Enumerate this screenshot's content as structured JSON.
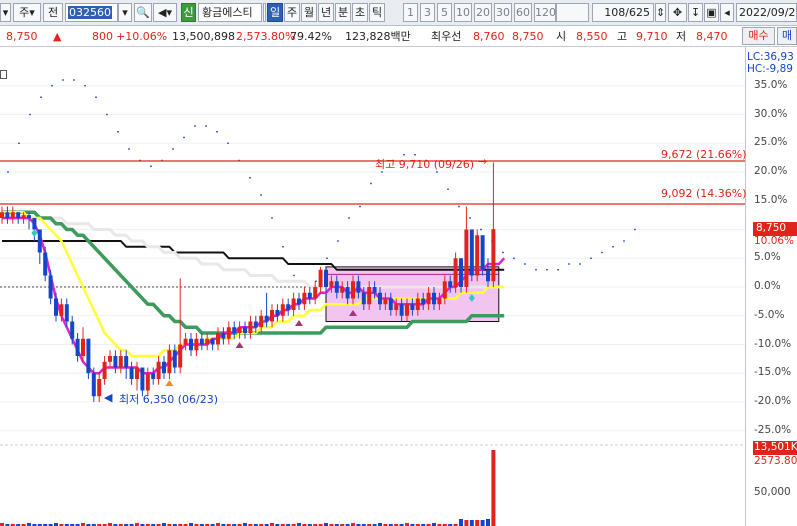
{
  "toolbar": {
    "period_select": "주",
    "market_select": "전",
    "stock_code": "032560",
    "indicator_badge": "신",
    "stock_name": "황금에스티",
    "tabs": [
      "일",
      "주",
      "월",
      "년",
      "분",
      "초",
      "틱"
    ],
    "active_tab": "일",
    "intervals": [
      "1",
      "3",
      "5",
      "10",
      "20",
      "30",
      "60",
      "120"
    ],
    "count": "108/625",
    "date": "2022/09/26"
  },
  "quote": {
    "price": "8,750",
    "direction": "▲",
    "change": "800",
    "change_pct": "+10.06%",
    "volume": "13,500,898",
    "volume_pct": "2,573.80%",
    "ratio": "79.42%",
    "trade_value": "123,828백만",
    "best_label": "최우선",
    "best_ask": "8,760",
    "best_bid": "8,750",
    "open_label": "시",
    "open": "8,550",
    "high_label": "고",
    "high": "9,710",
    "low_label": "저",
    "low": "8,470",
    "buy_button": "매수",
    "sell_button": "매"
  },
  "legend": {
    "lc": "LC:36,93",
    "hc": "HC:-9,89"
  },
  "annotations": {
    "high_marker": "최고 9,710 (09/26)",
    "low_marker": "최저 6,350 (06/23)",
    "line1": "9,672 (21.66%)",
    "line2": "9,092 (14.36%)",
    "price_tag": "8,750",
    "price_tag_pct": "10.06%",
    "volume_tag": "13,501K",
    "volume_tag2": "2573.80"
  },
  "colors": {
    "up": "#e0241c",
    "down": "#1446c8",
    "ma5": "#e61fd2",
    "ma20": "#ffff33",
    "ma60": "#3f9b5d",
    "ma120": "#e8e8e8",
    "ma240": "#111111",
    "box": "#f2c4f0"
  },
  "chart_data": {
    "type": "candlestick",
    "y_axis_ticks": [
      "35.0%",
      "30.0%",
      "25.0%",
      "20.0%",
      "15.0%",
      "10.0%",
      "5.0%",
      "0.0%",
      "-5.0%",
      "-10.0%",
      "-15.0%",
      "-20.0%",
      "-25.0%"
    ],
    "volume_axis_ticks": [
      "50,000"
    ],
    "candles": [
      {
        "o": 12,
        "c": 13,
        "h": 14,
        "l": 11
      },
      {
        "o": 13,
        "c": 12,
        "h": 14,
        "l": 11
      },
      {
        "o": 12,
        "c": 13,
        "h": 14,
        "l": 11
      },
      {
        "o": 13,
        "c": 12,
        "h": 13,
        "l": 11
      },
      {
        "o": 12,
        "c": 12.5,
        "h": 13,
        "l": 11
      },
      {
        "o": 12.5,
        "c": 12,
        "h": 13,
        "l": 10
      },
      {
        "o": 12,
        "c": 10,
        "h": 12,
        "l": 8
      },
      {
        "o": 10,
        "c": 6,
        "h": 10,
        "l": 4
      },
      {
        "o": 6,
        "c": 2,
        "h": 7,
        "l": 1
      },
      {
        "o": 2,
        "c": -2,
        "h": 3,
        "l": -3
      },
      {
        "o": -2,
        "c": -5,
        "h": -1,
        "l": -6
      },
      {
        "o": -5,
        "c": -3,
        "h": -2,
        "l": -6
      },
      {
        "o": -3,
        "c": -6,
        "h": -2,
        "l": -7
      },
      {
        "o": -6,
        "c": -9,
        "h": -5,
        "l": -10
      },
      {
        "o": -9,
        "c": -12,
        "h": -8,
        "l": -13
      },
      {
        "o": -12,
        "c": -9,
        "h": -7,
        "l": -13
      },
      {
        "o": -9,
        "c": -15,
        "h": -9,
        "l": -16
      },
      {
        "o": -15,
        "c": -19,
        "h": -14,
        "l": -20
      },
      {
        "o": -19,
        "c": -16,
        "h": -15,
        "l": -20
      },
      {
        "o": -16,
        "c": -13,
        "h": -12,
        "l": -17
      },
      {
        "o": -13,
        "c": -12,
        "h": -11,
        "l": -14
      },
      {
        "o": -12,
        "c": -14,
        "h": -11,
        "l": -15
      },
      {
        "o": -14,
        "c": -12,
        "h": -11,
        "l": -15
      },
      {
        "o": -12,
        "c": -14,
        "h": -11,
        "l": -16
      },
      {
        "o": -14,
        "c": -16,
        "h": -13,
        "l": -17
      },
      {
        "o": -16,
        "c": -14,
        "h": -13,
        "l": -18
      },
      {
        "o": -14,
        "c": -18,
        "h": -14,
        "l": -19
      },
      {
        "o": -18,
        "c": -15,
        "h": -14,
        "l": -19
      },
      {
        "o": -15,
        "c": -16,
        "h": -14,
        "l": -17
      },
      {
        "o": -16,
        "c": -13,
        "h": -12,
        "l": -17
      },
      {
        "o": -13,
        "c": -15,
        "h": -12,
        "l": -16
      },
      {
        "o": -15,
        "c": -11,
        "h": -10,
        "l": -16
      },
      {
        "o": -11,
        "c": -14,
        "h": -10,
        "l": -15
      },
      {
        "o": -14,
        "c": -10,
        "h": 1.5,
        "l": -15
      },
      {
        "o": -10,
        "c": -9,
        "h": -8,
        "l": -11
      },
      {
        "o": -9,
        "c": -11,
        "h": -8,
        "l": -12
      },
      {
        "o": -11,
        "c": -9,
        "h": -8,
        "l": -12
      },
      {
        "o": -9,
        "c": -10,
        "h": -8,
        "l": -11
      },
      {
        "o": -10,
        "c": -9,
        "h": -8,
        "l": -11
      },
      {
        "o": -9,
        "c": -10,
        "h": -9,
        "l": -11
      },
      {
        "o": -10,
        "c": -8,
        "h": -7,
        "l": -11
      },
      {
        "o": -8,
        "c": -9,
        "h": -7,
        "l": -10
      },
      {
        "o": -9,
        "c": -7,
        "h": -6,
        "l": -10
      },
      {
        "o": -7,
        "c": -8,
        "h": -6,
        "l": -9
      },
      {
        "o": -8,
        "c": -7,
        "h": -6,
        "l": -9
      },
      {
        "o": -7,
        "c": -8,
        "h": -6,
        "l": -9
      },
      {
        "o": -8,
        "c": -6,
        "h": -5,
        "l": -9
      },
      {
        "o": -6,
        "c": -7,
        "h": -5,
        "l": -8
      },
      {
        "o": -7,
        "c": -5,
        "h": -4,
        "l": -8
      },
      {
        "o": -5,
        "c": -6,
        "h": -1,
        "l": -7
      },
      {
        "o": -6,
        "c": -4,
        "h": -3,
        "l": -7
      },
      {
        "o": -4,
        "c": -5,
        "h": -3,
        "l": -6
      },
      {
        "o": -5,
        "c": -3,
        "h": -2,
        "l": -6
      },
      {
        "o": -3,
        "c": -4,
        "h": -2,
        "l": -5
      },
      {
        "o": -4,
        "c": -2,
        "h": -1,
        "l": -5
      },
      {
        "o": -2,
        "c": -3,
        "h": -1,
        "l": -4
      },
      {
        "o": -3,
        "c": -1,
        "h": 0,
        "l": -4
      },
      {
        "o": -1,
        "c": -2,
        "h": 0,
        "l": -3
      },
      {
        "o": -2,
        "c": 0,
        "h": 1,
        "l": -3
      },
      {
        "o": 0,
        "c": 3,
        "h": 3.5,
        "l": -1
      },
      {
        "o": 3,
        "c": 0,
        "h": 3,
        "l": -1
      },
      {
        "o": 0,
        "c": 1,
        "h": 2,
        "l": -1
      },
      {
        "o": 1,
        "c": -1,
        "h": 2,
        "l": -2
      },
      {
        "o": -1,
        "c": 0,
        "h": 1,
        "l": -2
      },
      {
        "o": 0,
        "c": -2,
        "h": 1,
        "l": -3
      },
      {
        "o": -2,
        "c": 1,
        "h": 2,
        "l": -3
      },
      {
        "o": 1,
        "c": -1,
        "h": 2,
        "l": -2
      },
      {
        "o": -1,
        "c": -3,
        "h": 0,
        "l": -4
      },
      {
        "o": -3,
        "c": 0,
        "h": 1,
        "l": -4
      },
      {
        "o": 0,
        "c": -1,
        "h": 1,
        "l": -2
      },
      {
        "o": -1,
        "c": -3,
        "h": 0,
        "l": -4
      },
      {
        "o": -3,
        "c": -2,
        "h": -1,
        "l": -4
      },
      {
        "o": -2,
        "c": -4,
        "h": -1,
        "l": -5
      },
      {
        "o": -4,
        "c": -3,
        "h": -2,
        "l": -5
      },
      {
        "o": -3,
        "c": -5,
        "h": -2,
        "l": -6
      },
      {
        "o": -5,
        "c": -3,
        "h": -2,
        "l": -6
      },
      {
        "o": -3,
        "c": -4,
        "h": -2,
        "l": -5
      },
      {
        "o": -4,
        "c": -2,
        "h": -1,
        "l": -5
      },
      {
        "o": -2,
        "c": -3,
        "h": -1,
        "l": -4
      },
      {
        "o": -3,
        "c": -1,
        "h": 0,
        "l": -4
      },
      {
        "o": -1,
        "c": -3,
        "h": 0,
        "l": -4
      },
      {
        "o": -3,
        "c": -2,
        "h": -1,
        "l": -4
      },
      {
        "o": -2,
        "c": 1,
        "h": 2,
        "l": -3
      },
      {
        "o": 1,
        "c": 0,
        "h": 2,
        "l": -1
      },
      {
        "o": 0,
        "c": 5,
        "h": 6,
        "l": -1
      },
      {
        "o": 5,
        "c": 0,
        "h": 5,
        "l": -1
      },
      {
        "o": 0,
        "c": 10,
        "h": 14,
        "l": -1
      },
      {
        "o": 10,
        "c": 2,
        "h": 10,
        "l": 1
      },
      {
        "o": 2,
        "c": 9,
        "h": 10,
        "l": 1
      },
      {
        "o": 9,
        "c": 3,
        "h": 9,
        "l": 2
      },
      {
        "o": 3,
        "c": 1,
        "h": 5,
        "l": 0
      },
      {
        "o": 1,
        "c": 10.06,
        "h": 21.66,
        "l": 0
      }
    ],
    "ma": {
      "ma5": [
        12,
        12,
        12,
        12,
        12,
        12,
        11,
        9,
        6,
        2,
        -2,
        -5,
        -7,
        -9,
        -11,
        -13,
        -14,
        -15,
        -15,
        -14,
        -14,
        -14,
        -14,
        -14,
        -14,
        -14,
        -15,
        -15,
        -15,
        -14,
        -14,
        -13,
        -12,
        -11,
        -10,
        -10,
        -10,
        -10,
        -10,
        -9,
        -9,
        -8,
        -8,
        -8,
        -7,
        -7,
        -7,
        -7,
        -6,
        -6,
        -5,
        -5,
        -4,
        -4,
        -3,
        -3,
        -2,
        -2,
        -2,
        -1,
        -1,
        0,
        0,
        0,
        -1,
        -1,
        0,
        -1,
        -1,
        -1,
        -2,
        -2,
        -2,
        -3,
        -3,
        -3,
        -3,
        -3,
        -3,
        -2,
        -2,
        -2,
        -1,
        0,
        0,
        1,
        2,
        3,
        3,
        3,
        4,
        4,
        4,
        5
      ],
      "ma20": [
        13,
        13,
        13,
        13,
        13,
        12,
        12,
        12,
        11,
        10,
        9,
        8,
        6,
        4,
        2,
        0,
        -2,
        -4,
        -6,
        -8,
        -9,
        -10,
        -11,
        -11,
        -12,
        -12,
        -12,
        -12,
        -12,
        -12,
        -11,
        -11,
        -11,
        -10,
        -10,
        -10,
        -10,
        -10,
        -9,
        -9,
        -9,
        -9,
        -9,
        -9,
        -8,
        -8,
        -8,
        -8,
        -7,
        -7,
        -7,
        -6,
        -6,
        -6,
        -5,
        -5,
        -5,
        -4,
        -4,
        -4,
        -3,
        -3,
        -3,
        -3,
        -3,
        -3,
        -3,
        -2,
        -2,
        -2,
        -2,
        -2,
        -2,
        -2,
        -2,
        -2,
        -2,
        -2,
        -2,
        -2,
        -2,
        -2,
        -2,
        -2,
        -2,
        -1,
        -1,
        -1,
        -1,
        -1,
        0,
        0,
        0,
        0
      ],
      "ma60": [
        13,
        13,
        13,
        13,
        13,
        13,
        13,
        12,
        12,
        12,
        11,
        11,
        10,
        10,
        9,
        9,
        8,
        7,
        6,
        5,
        4,
        3,
        2,
        1,
        0,
        -1,
        -2,
        -3,
        -3,
        -4,
        -5,
        -5,
        -6,
        -6,
        -7,
        -7,
        -7,
        -8,
        -8,
        -8,
        -8,
        -8,
        -8,
        -8,
        -8,
        -8,
        -8,
        -8,
        -8,
        -8,
        -8,
        -8,
        -8,
        -8,
        -8,
        -8,
        -8,
        -8,
        -8,
        -8,
        -7,
        -7,
        -7,
        -7,
        -7,
        -7,
        -7,
        -7,
        -7,
        -7,
        -7,
        -7,
        -7,
        -7,
        -7,
        -7,
        -6,
        -6,
        -6,
        -6,
        -6,
        -6,
        -6,
        -6,
        -6,
        -6,
        -6,
        -5,
        -5,
        -5,
        -5,
        -5,
        -5,
        -5
      ],
      "ma120": [
        12,
        12,
        12,
        12,
        12,
        12,
        12,
        12,
        12,
        12,
        12,
        12,
        11,
        11,
        11,
        11,
        11,
        10,
        10,
        10,
        10,
        9,
        9,
        9,
        8,
        8,
        8,
        7,
        7,
        7,
        6,
        6,
        6,
        5,
        5,
        5,
        5,
        4,
        4,
        4,
        4,
        3,
        3,
        3,
        3,
        3,
        2,
        2,
        2,
        2,
        2,
        1,
        1,
        1,
        1,
        1,
        1,
        0,
        0,
        0,
        0,
        0,
        0,
        0,
        0,
        0,
        0,
        0,
        0,
        0,
        0,
        0,
        0,
        0,
        0,
        0,
        0,
        0,
        0,
        0,
        0,
        0,
        0,
        0,
        0,
        0,
        0,
        0,
        0,
        0,
        0,
        0,
        0,
        0
      ],
      "ma240": [
        8,
        8,
        8,
        8,
        8,
        8,
        8,
        8,
        8,
        8,
        8,
        8,
        8,
        8,
        8,
        8,
        8,
        8,
        8,
        8,
        8,
        8,
        8,
        7,
        7,
        7,
        7,
        7,
        7,
        7,
        7,
        7,
        6,
        6,
        6,
        6,
        6,
        6,
        6,
        6,
        6,
        6,
        5,
        5,
        5,
        5,
        5,
        5,
        5,
        5,
        5,
        5,
        5,
        4,
        4,
        4,
        4,
        4,
        4,
        4,
        4,
        4,
        3,
        3,
        3,
        3,
        3,
        3,
        3,
        3,
        3,
        3,
        3,
        3,
        3,
        3,
        3,
        3,
        3,
        3,
        3,
        3,
        3,
        3,
        3,
        3,
        3,
        3,
        3,
        3,
        3,
        3,
        3,
        3
      ]
    },
    "projection_dots": [
      20,
      25,
      30,
      33,
      35,
      36,
      36,
      35,
      33,
      30,
      27,
      24,
      22,
      21,
      22,
      24,
      26,
      28,
      28,
      27,
      25,
      22,
      19,
      16,
      12,
      7,
      2,
      -2,
      1,
      5,
      8,
      12,
      14,
      18,
      20,
      22,
      23,
      23,
      22,
      20,
      17,
      14,
      12,
      10,
      8,
      6,
      5,
      4,
      3,
      3,
      3,
      4,
      4,
      5,
      6,
      7,
      8,
      10
    ]
  }
}
